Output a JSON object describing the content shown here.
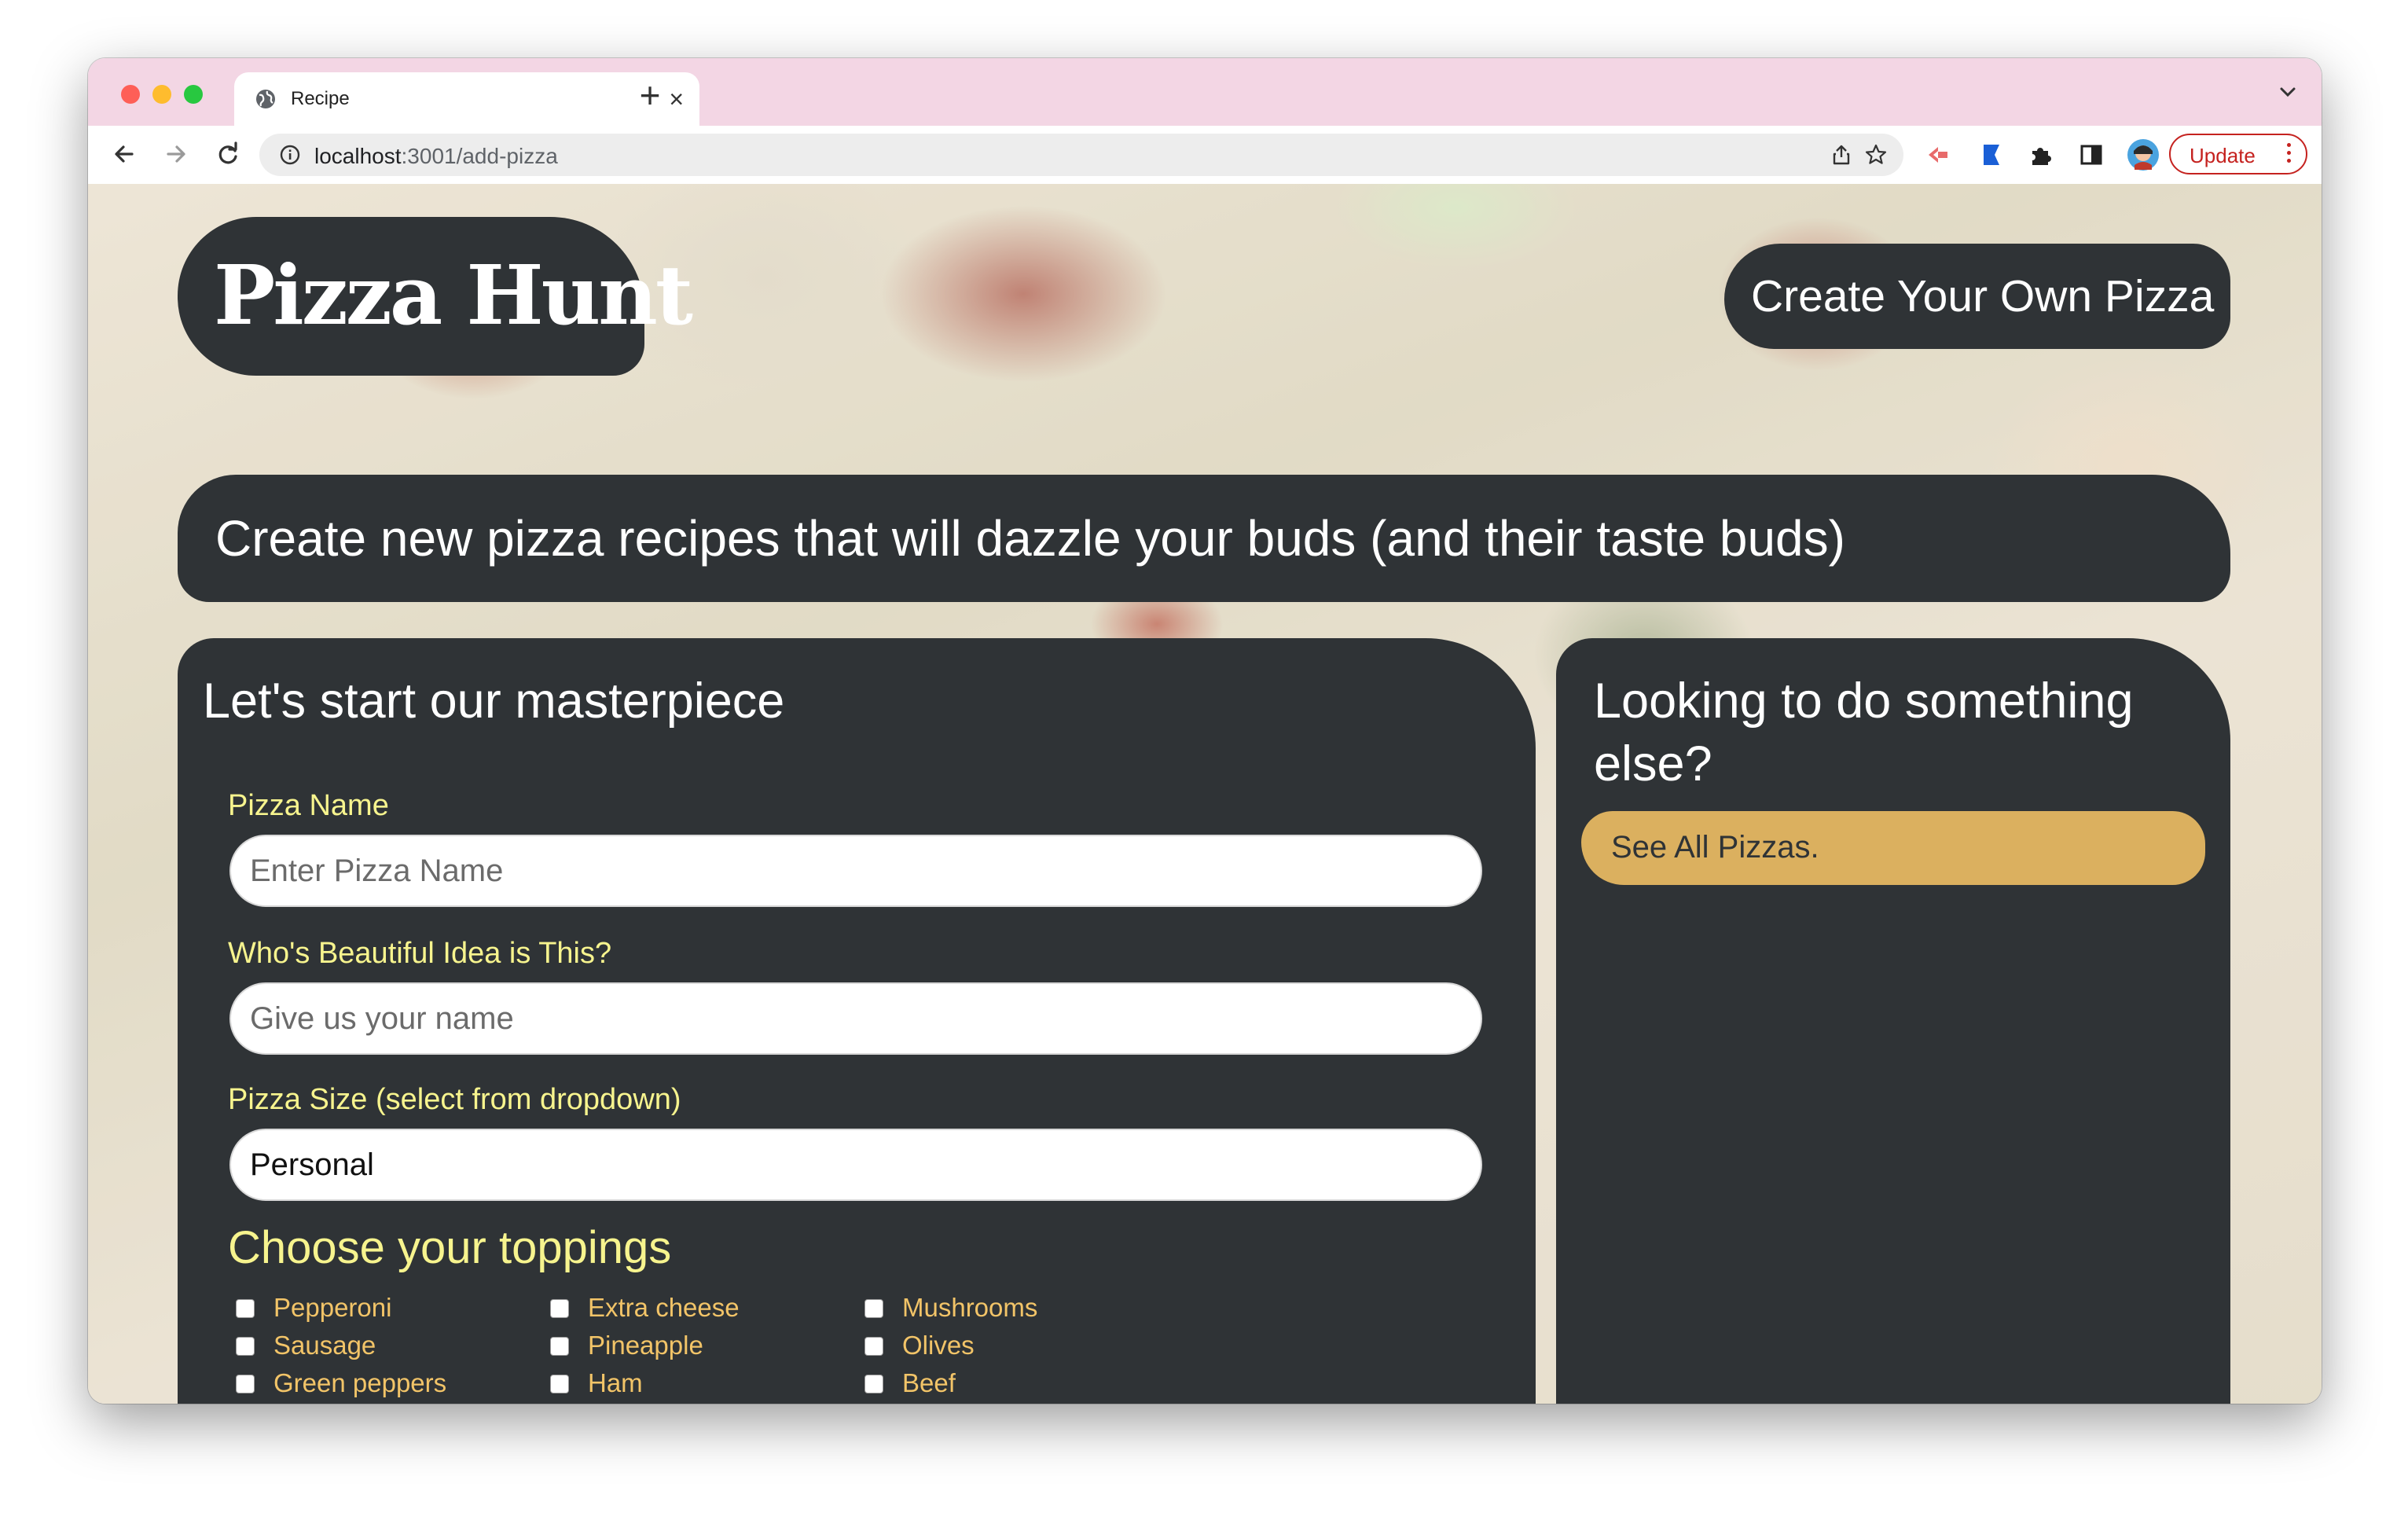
{
  "browser": {
    "tab_title": "Recipe",
    "tab_close": "×",
    "new_tab": "+",
    "url_host": "localhost",
    "url_path": ":3001/add-pizza",
    "update_label": "Update"
  },
  "header": {
    "logo_text": "Pizza Hunt",
    "create_button": "Create Your Own Pizza"
  },
  "hero": {
    "tagline": "Create new pizza recipes that will dazzle your buds (and their taste buds)"
  },
  "form": {
    "heading": "Let's start our masterpiece",
    "pizza_name": {
      "label": "Pizza Name",
      "placeholder": "Enter Pizza Name"
    },
    "creator": {
      "label": "Who's Beautiful Idea is This?",
      "placeholder": "Give us your name"
    },
    "size": {
      "label": "Pizza Size (select from dropdown)",
      "value": "Personal"
    },
    "toppings_title": "Choose your toppings",
    "toppings": [
      "Pepperoni",
      "Extra cheese",
      "Mushrooms",
      "Sausage",
      "Pineapple",
      "Olives",
      "Green peppers",
      "Ham",
      "Beef"
    ]
  },
  "sidebar": {
    "heading_line1": "Looking to do something",
    "heading_line2": "else?",
    "see_all_button": "See All Pizzas."
  },
  "colors": {
    "panel": "#2f3336",
    "label_yellow": "#f7f48e",
    "topping_orange": "#f2c468",
    "button_gold": "#dbb05f",
    "tab_strip_pink": "#f3d6e4"
  },
  "icons": {
    "tab": "globe-icon",
    "nav": [
      "back-arrow-icon",
      "forward-arrow-icon",
      "reload-icon"
    ],
    "omnibox": [
      "info-icon",
      "share-icon",
      "star-icon"
    ],
    "extensions": [
      "extension-red-icon",
      "extension-blue-icon",
      "puzzle-icon",
      "side-panel-icon",
      "profile-avatar-icon"
    ]
  }
}
